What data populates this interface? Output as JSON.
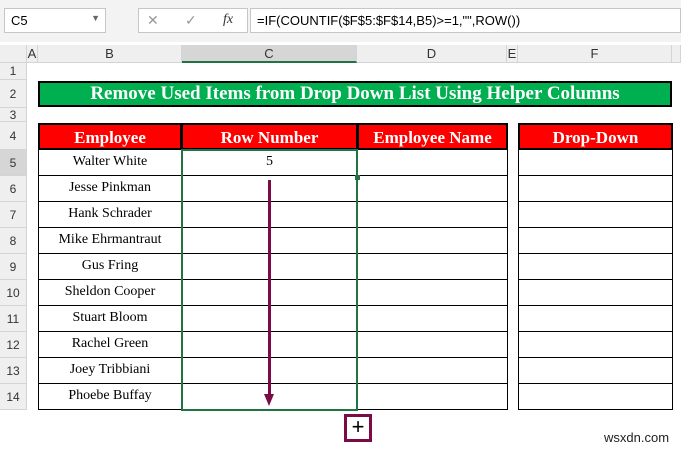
{
  "name_box": "C5",
  "formula_icons": [
    "cancel-icon",
    "enter-icon",
    "fx-icon"
  ],
  "fx_label": "fx",
  "formula": "=IF(COUNTIF($F$5:$F$14,B5)>=1,\"\",ROW())",
  "columns": [
    "A",
    "B",
    "C",
    "D",
    "E",
    "F"
  ],
  "rows": [
    "1",
    "2",
    "3",
    "4",
    "5",
    "6",
    "7",
    "8",
    "9",
    "10",
    "11",
    "12",
    "13",
    "14"
  ],
  "title": "Remove Used Items from Drop Down List Using Helper Columns",
  "headers": {
    "employee": "Employee",
    "row_number": "Row Number",
    "employee_name": "Employee Name",
    "drop_down": "Drop-Down"
  },
  "employees": [
    "Walter White",
    "Jesse Pinkman",
    "Hank Schrader",
    "Mike Ehrmantraut",
    "Gus Fring",
    "Sheldon Cooper",
    "Stuart Bloom",
    "Rachel Green",
    "Joey Tribbiani",
    "Phoebe Buffay"
  ],
  "row_numbers": [
    "5",
    "",
    "",
    "",
    "",
    "",
    "",
    "",
    "",
    ""
  ],
  "fill_handle": "+",
  "watermark": "wsxdn.com",
  "colors": {
    "title_bg": "#00b050",
    "header_bg": "#ff0000",
    "selection": "#217346",
    "arrow": "#7b0a47"
  }
}
